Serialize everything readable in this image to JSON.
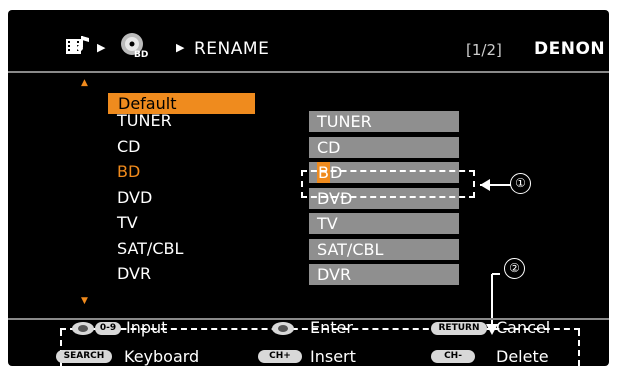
{
  "header": {
    "title": "RENAME",
    "page": "[1/2]",
    "brand": "DENON",
    "icons": [
      "music-film-icon",
      "bd-disc-icon"
    ]
  },
  "defaultButton": "Default",
  "rows": [
    {
      "label": "TUNER",
      "value": "TUNER"
    },
    {
      "label": "CD",
      "value": "CD"
    },
    {
      "label": "BD",
      "value": "BD",
      "selected": true
    },
    {
      "label": "DVD",
      "value": "DVD"
    },
    {
      "label": "TV",
      "value": "TV"
    },
    {
      "label": "SAT/CBL",
      "value": "SAT/CBL"
    },
    {
      "label": "DVR",
      "value": "DVR"
    }
  ],
  "editCaret": "B",
  "editRest": "D",
  "callouts": {
    "one": "①",
    "two": "②"
  },
  "guide": {
    "input_key": "0-9",
    "input": "Input",
    "enter": "Enter",
    "return_key": "RETURN",
    "cancel": "Cancel",
    "search_key": "SEARCH",
    "keyboard": "Keyboard",
    "chplus_key": "CH+",
    "insert": "Insert",
    "chminus_key": "CH-",
    "delete": "Delete"
  },
  "colors": {
    "accent": "#ef8b1e",
    "field": "#8f8f8f",
    "background": "#000000"
  }
}
